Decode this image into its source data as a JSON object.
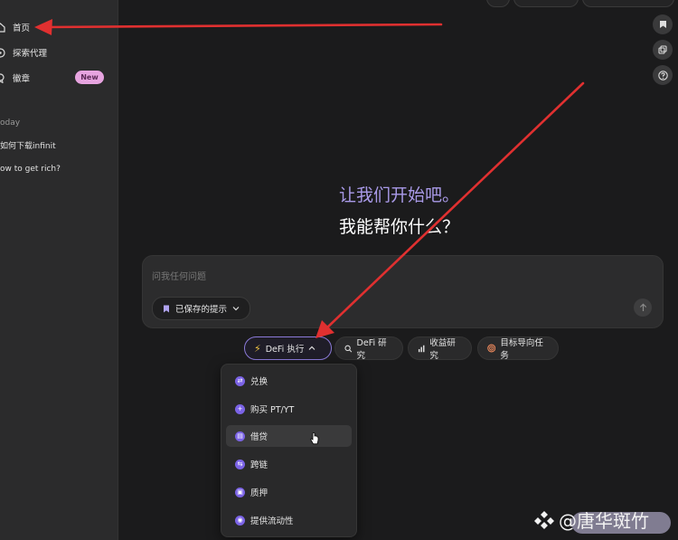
{
  "sidebar": {
    "items": [
      {
        "label": "首页",
        "icon": "home-icon"
      },
      {
        "label": "探索代理",
        "icon": "compass-icon"
      },
      {
        "label": "徽章",
        "icon": "badge-icon",
        "badge": "New"
      }
    ],
    "section_label": "oday",
    "history": [
      "如何下载infinit",
      "ow to get rich?"
    ]
  },
  "main": {
    "headline_1": "让我们开始吧。",
    "headline_2": "我能帮你什么？",
    "input_placeholder": "问我任何问题",
    "saved_prompts_label": "已保存的提示"
  },
  "chips": [
    {
      "label": "DeFi 执行",
      "icon": "lightning-icon",
      "active": true
    },
    {
      "label": "DeFi 研究",
      "icon": "search-icon"
    },
    {
      "label": "收益研究",
      "icon": "bar-chart-icon"
    },
    {
      "label": "目标导向任务",
      "icon": "target-icon"
    }
  ],
  "dropdown": {
    "items": [
      "兑换",
      "购买 PT/YT",
      "借贷",
      "跨链",
      "质押",
      "提供流动性"
    ],
    "hovered_index": 2
  },
  "watermark": {
    "text": "@唐华斑竹"
  },
  "colors": {
    "accent": "#8b7ad9",
    "headline_accent": "#a99ae8",
    "arrow": "#e03030",
    "badge": "#e7a4e0"
  }
}
